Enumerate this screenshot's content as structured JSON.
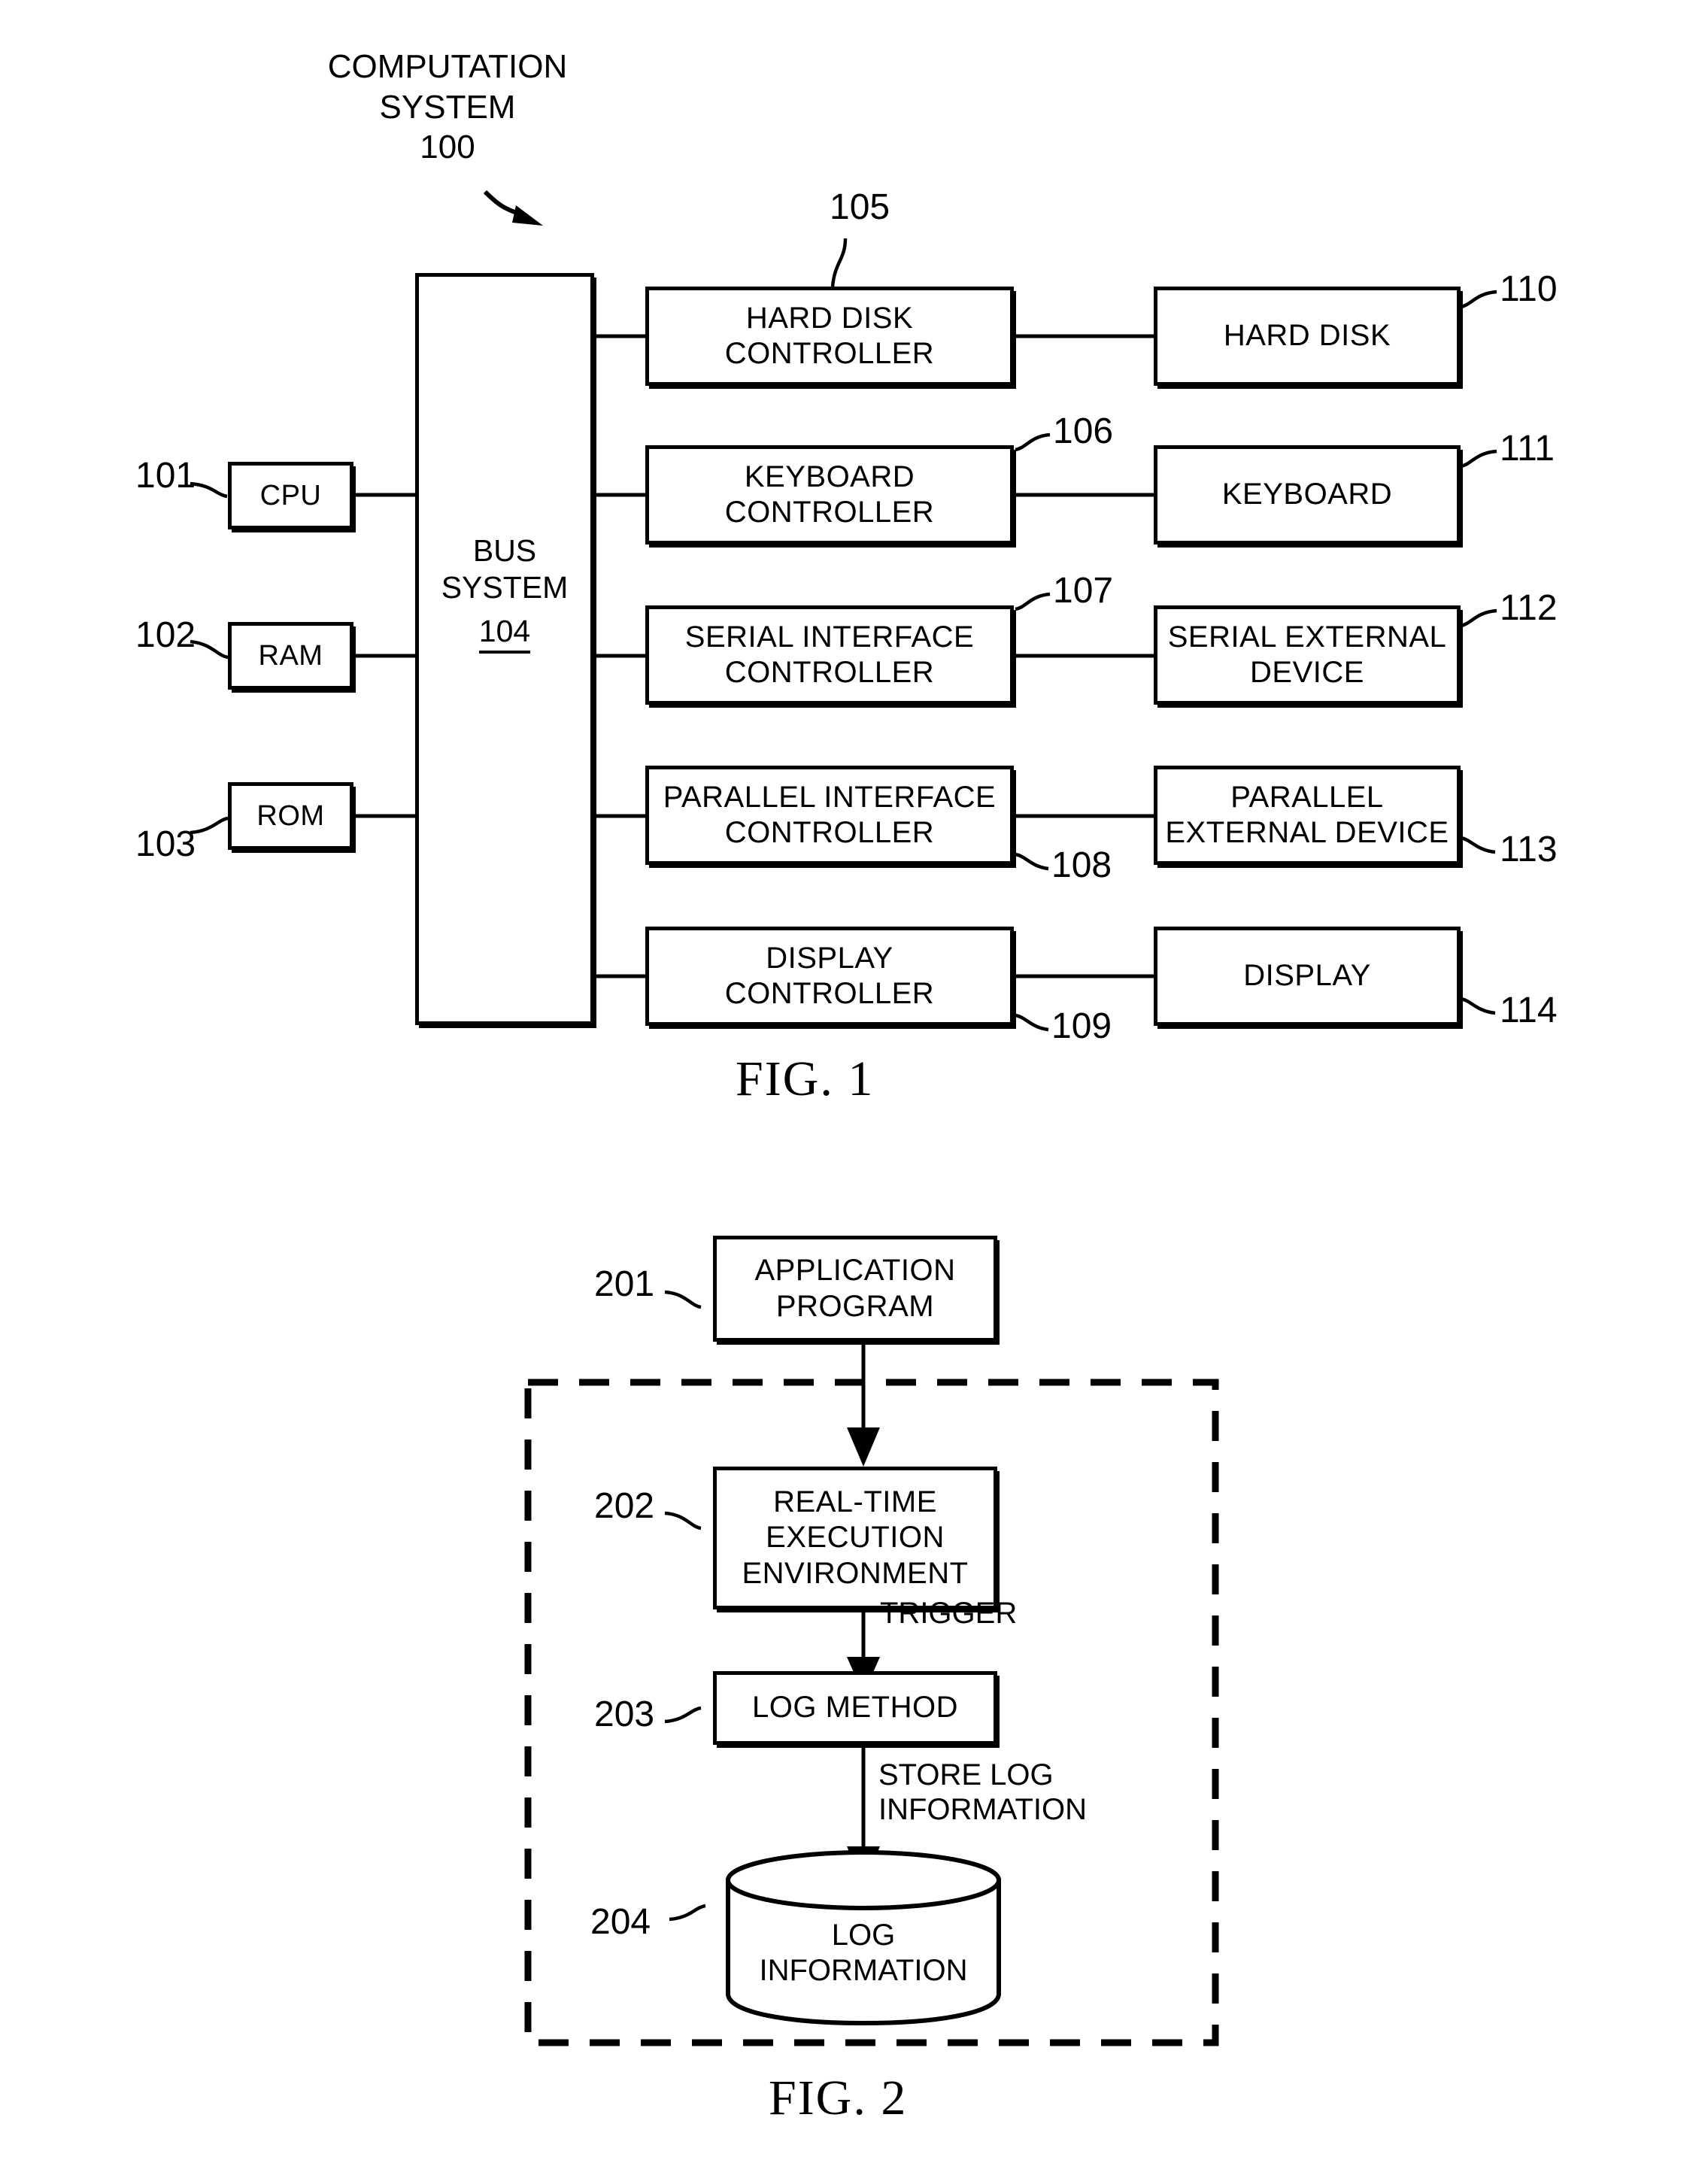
{
  "figure1": {
    "title": "COMPUTATION\nSYSTEM\n100",
    "caption": "FIG. 1",
    "bus": {
      "label": "BUS\nSYSTEM",
      "number": "104"
    },
    "left_nodes": [
      {
        "label": "CPU",
        "ref": "101"
      },
      {
        "label": "RAM",
        "ref": "102"
      },
      {
        "label": "ROM",
        "ref": "103"
      }
    ],
    "controllers": [
      {
        "label": "HARD DISK\nCONTROLLER",
        "ref": "105"
      },
      {
        "label": "KEYBOARD\nCONTROLLER",
        "ref": "106"
      },
      {
        "label": "SERIAL INTERFACE\nCONTROLLER",
        "ref": "107"
      },
      {
        "label": "PARALLEL INTERFACE\nCONTROLLER",
        "ref": "108"
      },
      {
        "label": "DISPLAY\nCONTROLLER",
        "ref": "109"
      }
    ],
    "devices": [
      {
        "label": "HARD DISK",
        "ref": "110"
      },
      {
        "label": "KEYBOARD",
        "ref": "111"
      },
      {
        "label": "SERIAL EXTERNAL\nDEVICE",
        "ref": "112"
      },
      {
        "label": "PARALLEL\nEXTERNAL DEVICE",
        "ref": "113"
      },
      {
        "label": "DISPLAY",
        "ref": "114"
      }
    ]
  },
  "figure2": {
    "caption": "FIG. 2",
    "nodes": [
      {
        "label": "APPLICATION\nPROGRAM",
        "ref": "201"
      },
      {
        "label": "REAL-TIME\nEXECUTION\nENVIRONMENT",
        "ref": "202"
      },
      {
        "label": "LOG METHOD",
        "ref": "203"
      },
      {
        "label": "LOG\nINFORMATION",
        "ref": "204"
      }
    ],
    "edge_labels": [
      {
        "text": "TRIGGER"
      },
      {
        "text": "STORE LOG\nINFORMATION"
      }
    ]
  }
}
